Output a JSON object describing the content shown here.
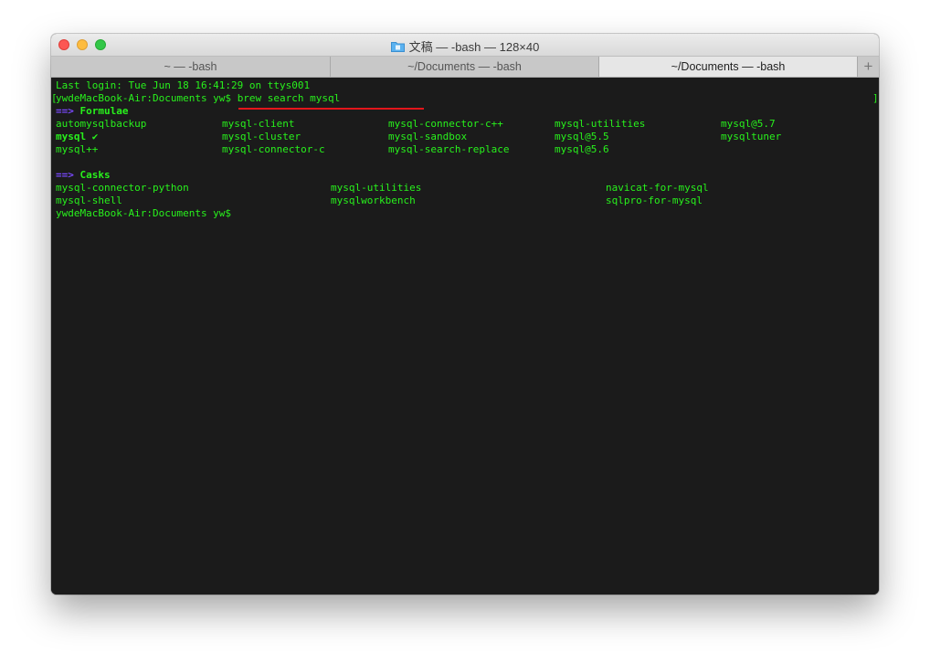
{
  "window": {
    "title": "文稿 — -bash — 128×40",
    "title_icon": "folder-icon",
    "traffic_lights": {
      "close_glyph": "×",
      "minimize_glyph": "−",
      "maximize_glyph": ""
    }
  },
  "tabs": [
    {
      "label": "~ — -bash",
      "active": false
    },
    {
      "label": "~/Documents — -bash",
      "active": false
    },
    {
      "label": "~/Documents — -bash",
      "active": true
    }
  ],
  "new_tab_glyph": "+",
  "terminal": {
    "last_login": "Last login: Tue Jun 18 16:41:29 on ttys001",
    "prompt": "ywdeMacBook-Air:Documents yw$",
    "command": "brew search mysql",
    "prompt_prefix": "[",
    "prompt_suffix": "]",
    "formulae_header": {
      "arrow": "==>",
      "label": "Formulae"
    },
    "formulae_rows": [
      [
        "automysqlbackup",
        "mysql-client",
        "mysql-connector-c++",
        "mysql-utilities",
        "mysql@5.7"
      ],
      [
        "mysql ✔",
        "mysql-cluster",
        "mysql-sandbox",
        "mysql@5.5",
        "mysqltuner"
      ],
      [
        "mysql++",
        "mysql-connector-c",
        "mysql-search-replace",
        "mysql@5.6",
        ""
      ]
    ],
    "casks_header": {
      "arrow": "==>",
      "label": "Casks"
    },
    "casks_rows": [
      [
        "mysql-connector-python",
        "mysql-utilities",
        "navicat-for-mysql"
      ],
      [
        "mysql-shell",
        "mysqlworkbench",
        "sqlpro-for-mysql"
      ]
    ],
    "final_prompt": "ywdeMacBook-Air:Documents yw$"
  },
  "colors": {
    "terminal_text": "#28f21c",
    "header_arrow": "#7a49ff",
    "annotation_underline": "#e3161b"
  }
}
